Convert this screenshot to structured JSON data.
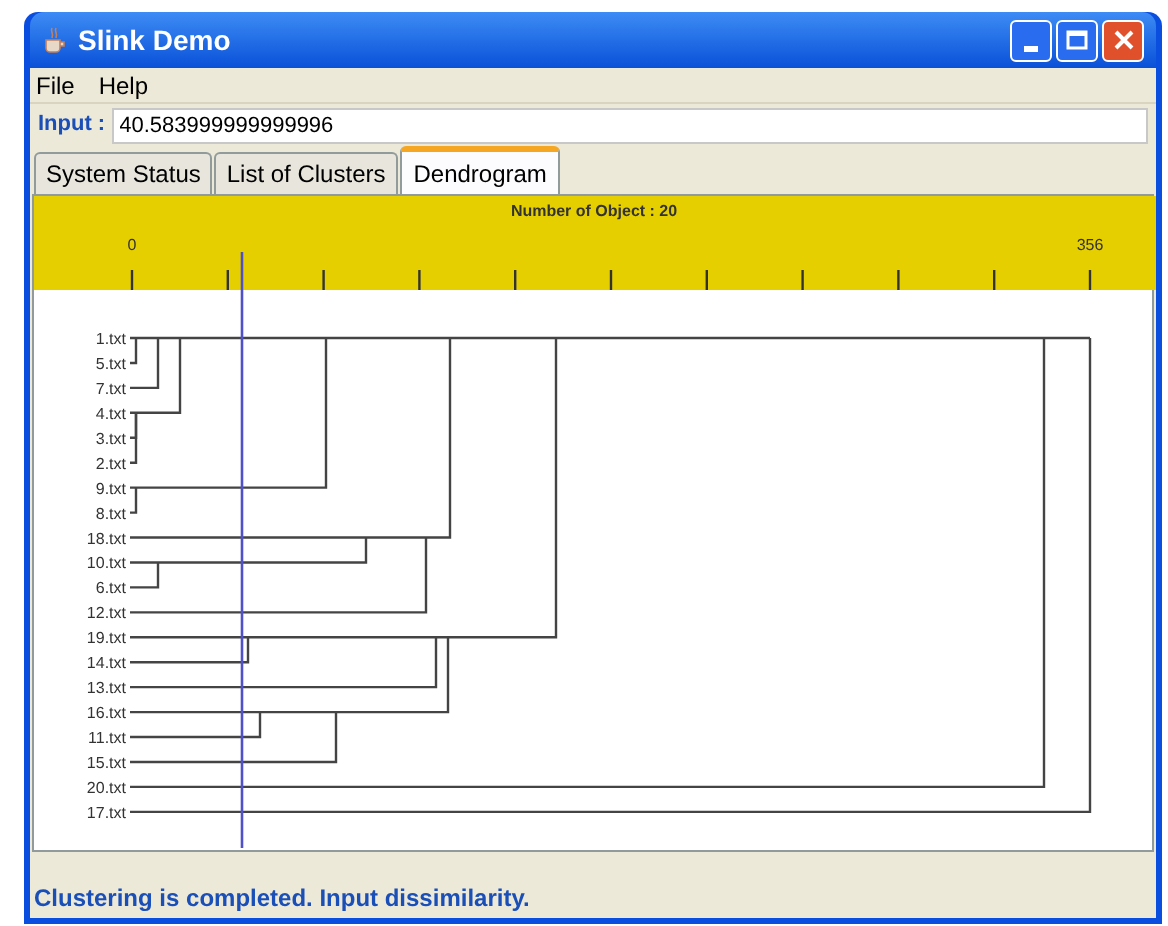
{
  "window": {
    "title": "Slink Demo"
  },
  "menu": [
    "File",
    "Help"
  ],
  "input": {
    "label": "Input :",
    "value": "40.583999999999996"
  },
  "tabs": [
    {
      "label": "System Status",
      "selected": false
    },
    {
      "label": "List of Clusters",
      "selected": false
    },
    {
      "label": "Dendrogram",
      "selected": true
    }
  ],
  "dendrogram": {
    "title": "Number of Object : 20",
    "axis_labels": [
      "0",
      "356"
    ],
    "leaves": [
      "1.txt",
      "5.txt",
      "7.txt",
      "4.txt",
      "3.txt",
      "2.txt",
      "9.txt",
      "8.txt",
      "18.txt",
      "10.txt",
      "6.txt",
      "12.txt",
      "19.txt",
      "14.txt",
      "13.txt",
      "16.txt",
      "11.txt",
      "15.txt",
      "20.txt",
      "17.txt"
    ]
  },
  "status_bar": "Clustering is completed. Input dissimilarity."
}
